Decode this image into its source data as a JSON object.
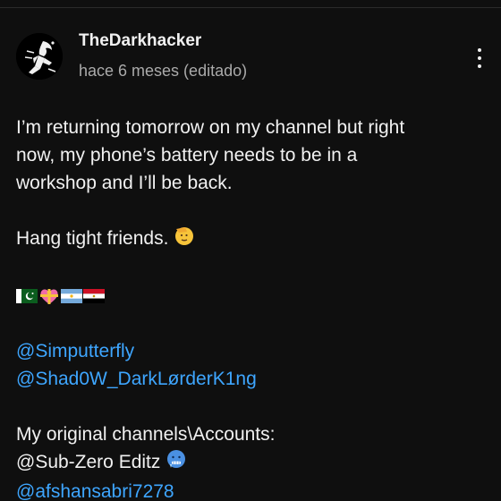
{
  "post": {
    "author": "TheDarkhacker",
    "timestamp": "hace 6 meses (editado)",
    "lines": {
      "l1": "I’m returning tomorrow on my channel but right",
      "l2": "now, my phone’s battery needs to be in a",
      "l3": "workshop and I’ll be back.",
      "l4": "Hang tight friends.",
      "l5": "My original channels\\Accounts:"
    },
    "mentions": {
      "m1": "@Simputterfly",
      "m2": "@Shad0W_DarkLørderK1ng",
      "m3": "@Sub-Zero Editz",
      "m4": "@afshansabri7278"
    },
    "emojis": [
      "saluting-face-emoji",
      "pakistan-flag-emoji",
      "heart-with-ribbon-emoji",
      "argentina-flag-emoji",
      "egypt-flag-emoji",
      "cold-face-emoji"
    ]
  },
  "colors": {
    "background": "#0f0f0f",
    "text": "#f1f1f1",
    "secondary_text": "#aaaaaa",
    "mention": "#3ea6ff"
  }
}
